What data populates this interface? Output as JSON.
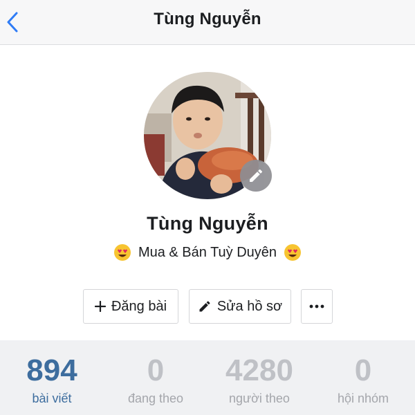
{
  "header": {
    "title": "Tùng Nguyễn"
  },
  "profile": {
    "name": "Tùng Nguyễn",
    "bio": "Mua & Bán Tuỳ Duyên"
  },
  "actions": {
    "post_label": "Đăng bài",
    "edit_label": "Sửa hồ sơ"
  },
  "stats": [
    {
      "value": "894",
      "label": "bài viết"
    },
    {
      "value": "0",
      "label": "đang theo"
    },
    {
      "value": "4280",
      "label": "người theo"
    },
    {
      "value": "0",
      "label": "hội nhóm"
    }
  ],
  "colors": {
    "accent": "#3d6d9e",
    "back_arrow": "#2f7cf6",
    "stat_muted": "#bfc1c6"
  },
  "icons": {
    "back": "chevron-left-icon",
    "edit_avatar": "pencil-icon",
    "post": "plus-icon",
    "edit": "pencil-icon",
    "more": "ellipsis-icon",
    "bio_emoji": "heart-eyes-emoji"
  }
}
